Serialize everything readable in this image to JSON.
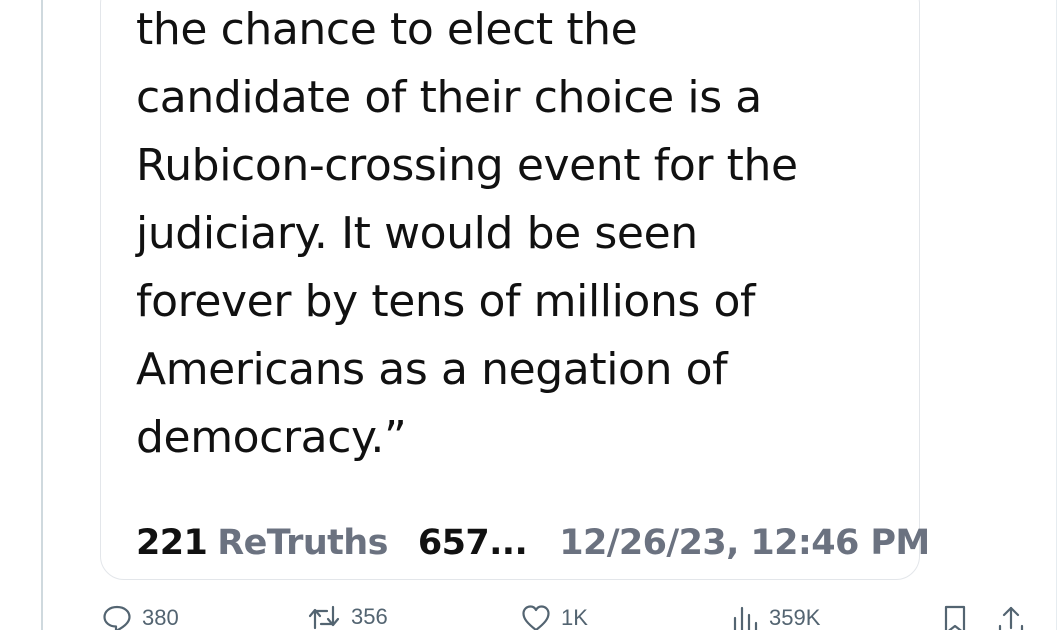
{
  "post": {
    "body_lines": [
      "the chance to elect the",
      "candidate of their choice is a",
      "Rubicon-crossing event for the",
      "judiciary. It would be seen",
      "forever by tens of millions of",
      "Americans as a negation of",
      "democracy.”"
    ],
    "retruths_count": "221",
    "retruths_label": "ReTruths",
    "likes_truncated": "657...",
    "timestamp": "12/26/23, 12:46 PM"
  },
  "actions": {
    "replies": "380",
    "reposts": "356",
    "likes": "1K",
    "views": "359K",
    "icons": [
      "reply-icon",
      "repost-icon",
      "like-icon",
      "views-icon",
      "bookmark-icon",
      "share-icon"
    ]
  },
  "colors": {
    "text": "#111111",
    "muted": "#6b7280",
    "action": "#536471",
    "border": "#e3e6ea"
  }
}
